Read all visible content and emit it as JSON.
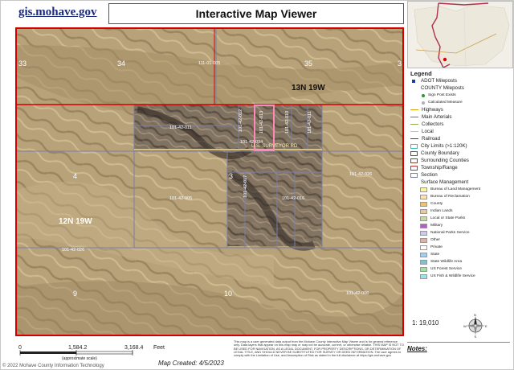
{
  "header": {
    "logo_text": "gis.mohave.gov",
    "title": "Interactive Map Viewer"
  },
  "map": {
    "section_labels": {
      "s33": "33",
      "s34": "34",
      "s35": "35",
      "s3": "3",
      "s4": "4",
      "s9": "9",
      "s10": "10",
      "s3b": "3"
    },
    "township_labels": {
      "t1": "13N 19W",
      "t2": "12N 19W"
    },
    "parcel_labels": {
      "p1": "111-01-005",
      "p2": "101-42-011",
      "p3": "101-42-034",
      "p4": "101-42-005",
      "p5": "101-42-026",
      "p6": "101-42-026",
      "p7": "101-42-006",
      "p8": "101-42-017",
      "p9": "101-42-016",
      "p10": "101-42-012",
      "p11": "101-42-013",
      "p12": "101-42-010",
      "p13": "101-42-011"
    },
    "road_label": "U.S. SURVEYOR RD",
    "colors": {
      "boundary": "#d40000",
      "selected": "#ff88b8",
      "parcel_line": "#7a7fa8"
    }
  },
  "legend": {
    "title": "Legend",
    "items": [
      {
        "kind": "sq",
        "color": "#1a3ea8",
        "label": "ADOT Mileposts"
      },
      {
        "kind": "none",
        "label": "COUNTY Mileposts"
      },
      {
        "kind": "dotsmall",
        "color": "#2a9a2a",
        "label": "Sign Post Exists"
      },
      {
        "kind": "dotsmall",
        "color": "#b0b0b0",
        "label": "Calculated Measure"
      },
      {
        "kind": "line",
        "color": "#d8a000",
        "label": "Highways"
      },
      {
        "kind": "line",
        "color": "#b06030",
        "label": "Main Arterials"
      },
      {
        "kind": "line",
        "color": "#90b050",
        "label": "Collectors"
      },
      {
        "kind": "line",
        "color": "#c0c0c0",
        "label": "Local"
      },
      {
        "kind": "line",
        "color": "#444444",
        "label": "Railroad"
      },
      {
        "kind": "box",
        "color": "#30c0c0",
        "label": "City Limits (>1:120K)"
      },
      {
        "kind": "box",
        "color": "#555555",
        "label": "County Boundary"
      },
      {
        "kind": "box",
        "color": "#7a4a2a",
        "label": "Surrounding Counties"
      },
      {
        "kind": "box",
        "color": "#c03030",
        "label": "Township/Range"
      },
      {
        "kind": "box",
        "color": "#7a7fa8",
        "label": "Section"
      },
      {
        "kind": "none",
        "label": "Surface Management"
      },
      {
        "kind": "fillsmall",
        "color": "#fff3a0",
        "label": "Bureau of Land Management"
      },
      {
        "kind": "fillsmall",
        "color": "#ffe0b0",
        "label": "Bureau of Reclamation"
      },
      {
        "kind": "fillsmall",
        "color": "#f0c070",
        "label": "County"
      },
      {
        "kind": "fillsmall",
        "color": "#e8c8a0",
        "label": "Indian Lands"
      },
      {
        "kind": "fillsmall",
        "color": "#c8d8a0",
        "label": "Local or State Parks"
      },
      {
        "kind": "fillsmall",
        "color": "#b060c0",
        "label": "Military"
      },
      {
        "kind": "fillsmall",
        "color": "#d0c8f0",
        "label": "National Parks Service"
      },
      {
        "kind": "fillsmall",
        "color": "#e0b0a0",
        "label": "Other"
      },
      {
        "kind": "fillsmall",
        "color": "#ffffff",
        "label": "Private"
      },
      {
        "kind": "fillsmall",
        "color": "#a0d0f0",
        "label": "State"
      },
      {
        "kind": "fillsmall",
        "color": "#80c0d0",
        "label": "State Wildlife Area"
      },
      {
        "kind": "fillsmall",
        "color": "#a0e0a0",
        "label": "US Forest Service"
      },
      {
        "kind": "fillsmall",
        "color": "#a0e0e0",
        "label": "US Fish & Wildlife Service"
      }
    ]
  },
  "scale": {
    "ratio": "1: 19,010",
    "ticks": [
      "0",
      "1,584.2",
      "3,168.4"
    ],
    "unit": "Feet",
    "approx_note": "(approximate scale)",
    "map_created": "Map Created: 4/5/2023"
  },
  "disclaimer": "This map is a user generated data output from the Mohave County Interactive Map Viewer and is for general reference only. Data layers that appear on this map may or may not be accurate, current, or otherwise reliable. THIS MAP IS NOT TO BE USED FOR NAVIGATION, AS A LEGAL DOCUMENT, FOR PROPERTY DESCRIPTIONS, OR DETERMINATION OF LEGAL TITLE, AND SHOULD NEVER BE SUBSTITUTED FOR SURVEY OR DEED INFORMATION. The user agrees to comply with the Limitation of Use, and Assumption of Risk as stated in the full disclaimer at https://gis.mohave.gov",
  "notes_label": "Notes:",
  "footer_credit": "© 2022 Mohave County Information Technology"
}
